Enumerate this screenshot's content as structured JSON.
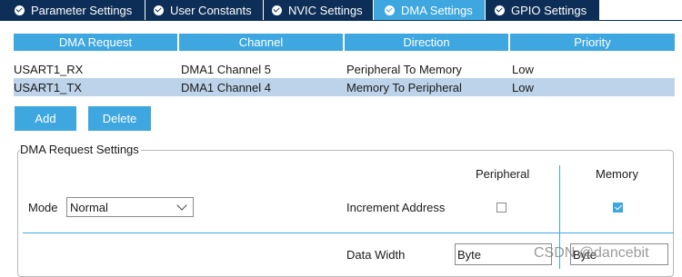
{
  "tabs": [
    {
      "label": "Parameter Settings",
      "active": false
    },
    {
      "label": "User Constants",
      "active": false
    },
    {
      "label": "NVIC Settings",
      "active": false
    },
    {
      "label": "DMA Settings",
      "active": true
    },
    {
      "label": "GPIO Settings",
      "active": false
    }
  ],
  "table": {
    "headers": [
      "DMA Request",
      "Channel",
      "Direction",
      "Priority"
    ],
    "rows": [
      {
        "request": "USART1_RX",
        "channel": "DMA1 Channel 5",
        "direction": "Peripheral To Memory",
        "priority": "Low",
        "selected": false
      },
      {
        "request": "USART1_TX",
        "channel": "DMA1 Channel 4",
        "direction": "Memory To Peripheral",
        "priority": "Low",
        "selected": true
      }
    ]
  },
  "buttons": {
    "add": "Add",
    "delete": "Delete"
  },
  "settings": {
    "legend": "DMA Request Settings",
    "peripheral_label": "Peripheral",
    "memory_label": "Memory",
    "mode_label": "Mode",
    "mode_value": "Normal",
    "increment_label": "Increment Address",
    "increment_peripheral_checked": false,
    "increment_memory_checked": true,
    "data_width_label": "Data Width",
    "data_width_peripheral": "Byte",
    "data_width_memory": "Byte"
  },
  "watermark": "CSDN @dancebit",
  "colors": {
    "tab_inactive": "#0d2e57",
    "accent": "#3fa7e0",
    "selected_row": "#bcd3ea"
  }
}
